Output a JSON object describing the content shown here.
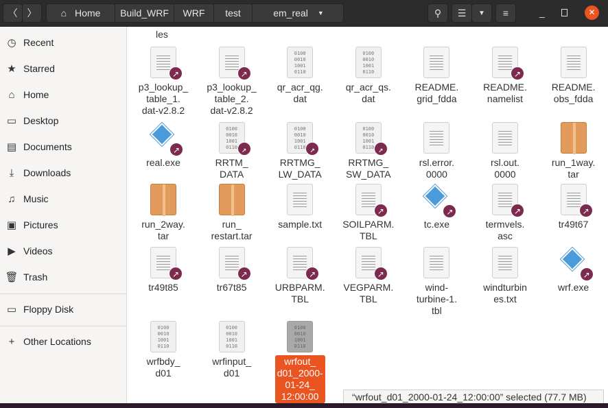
{
  "header": {
    "breadcrumbs": [
      "Home",
      "Build_WRF",
      "WRF",
      "test",
      "em_real"
    ]
  },
  "sidebar": {
    "items": [
      {
        "label": "Recent",
        "icon": "clock-icon",
        "glyph": "◷"
      },
      {
        "label": "Starred",
        "icon": "star-icon",
        "glyph": "★"
      },
      {
        "label": "Home",
        "icon": "home-icon",
        "glyph": "⌂"
      },
      {
        "label": "Desktop",
        "icon": "desktop-icon",
        "glyph": "▭"
      },
      {
        "label": "Documents",
        "icon": "documents-icon",
        "glyph": "▤"
      },
      {
        "label": "Downloads",
        "icon": "download-icon",
        "glyph": "⤓"
      },
      {
        "label": "Music",
        "icon": "music-icon",
        "glyph": "♫"
      },
      {
        "label": "Pictures",
        "icon": "pictures-icon",
        "glyph": "▣"
      },
      {
        "label": "Videos",
        "icon": "videos-icon",
        "glyph": "▶"
      },
      {
        "label": "Trash",
        "icon": "trash-icon",
        "glyph": "🗑"
      },
      {
        "label": "Floppy Disk",
        "icon": "drive-icon",
        "glyph": "▭"
      },
      {
        "label": "Other Locations",
        "icon": "plus-icon",
        "glyph": "+"
      }
    ]
  },
  "files": {
    "partial_label": "les",
    "rows": [
      [
        {
          "lines": [
            "p3_lookup_",
            "table_1.",
            "dat-v2.8.2"
          ],
          "type": "text",
          "link": true
        },
        {
          "lines": [
            "p3_lookup_",
            "table_2.",
            "dat-v2.8.2"
          ],
          "type": "text",
          "link": true
        },
        {
          "lines": [
            "qr_acr_qg.",
            "dat"
          ],
          "type": "binary"
        },
        {
          "lines": [
            "qr_acr_qs.",
            "dat"
          ],
          "type": "binary"
        },
        {
          "lines": [
            "README.",
            "grid_fdda"
          ],
          "type": "text"
        },
        {
          "lines": [
            "README.",
            "namelist"
          ],
          "type": "text",
          "link": true
        },
        {
          "lines": [
            "README.",
            "obs_fdda"
          ],
          "type": "text"
        }
      ],
      [
        {
          "lines": [
            "real.exe"
          ],
          "type": "exe",
          "link": true
        },
        {
          "lines": [
            "RRTM_",
            "DATA"
          ],
          "type": "binary",
          "link": true
        },
        {
          "lines": [
            "RRTMG_",
            "LW_DATA"
          ],
          "type": "binary",
          "link": true
        },
        {
          "lines": [
            "RRTMG_",
            "SW_DATA"
          ],
          "type": "binary",
          "link": true
        },
        {
          "lines": [
            "rsl.error.",
            "0000"
          ],
          "type": "text"
        },
        {
          "lines": [
            "rsl.out.",
            "0000"
          ],
          "type": "text"
        },
        {
          "lines": [
            "run_1way.",
            "tar"
          ],
          "type": "archive"
        }
      ],
      [
        {
          "lines": [
            "run_2way.",
            "tar"
          ],
          "type": "archive"
        },
        {
          "lines": [
            "run_",
            "restart.tar"
          ],
          "type": "archive"
        },
        {
          "lines": [
            "sample.txt"
          ],
          "type": "text"
        },
        {
          "lines": [
            "SOILPARM.",
            "TBL"
          ],
          "type": "text",
          "link": true
        },
        {
          "lines": [
            "tc.exe"
          ],
          "type": "exe",
          "link": true
        },
        {
          "lines": [
            "termvels.",
            "asc"
          ],
          "type": "text",
          "link": true
        },
        {
          "lines": [
            "tr49t67"
          ],
          "type": "text",
          "link": true
        }
      ],
      [
        {
          "lines": [
            "tr49t85"
          ],
          "type": "text",
          "link": true
        },
        {
          "lines": [
            "tr67t85"
          ],
          "type": "text",
          "link": true
        },
        {
          "lines": [
            "URBPARM.",
            "TBL"
          ],
          "type": "text",
          "link": true
        },
        {
          "lines": [
            "VEGPARM.",
            "TBL"
          ],
          "type": "text",
          "link": true
        },
        {
          "lines": [
            "wind-",
            "turbine-1.",
            "tbl"
          ],
          "type": "text"
        },
        {
          "lines": [
            "windturbin",
            "es.txt"
          ],
          "type": "text"
        },
        {
          "lines": [
            "wrf.exe"
          ],
          "type": "exe",
          "link": true
        }
      ],
      [
        {
          "lines": [
            "wrfbdy_",
            "d01"
          ],
          "type": "binary"
        },
        {
          "lines": [
            "wrfinput_",
            "d01"
          ],
          "type": "binary"
        },
        {
          "lines": [
            "wrfout_",
            "d01_2000-",
            "01-24_",
            "12:00:00"
          ],
          "type": "binary",
          "selected": true
        }
      ]
    ]
  },
  "binary_glyph": [
    "0100",
    "0010",
    "1001",
    "0110"
  ],
  "status": "“wrfout_d01_2000-01-24_12:00:00” selected (77.7 MB)",
  "colors": {
    "accent": "#e95420",
    "link_badge": "#7d2a4f",
    "header": "#2c2c2c"
  }
}
